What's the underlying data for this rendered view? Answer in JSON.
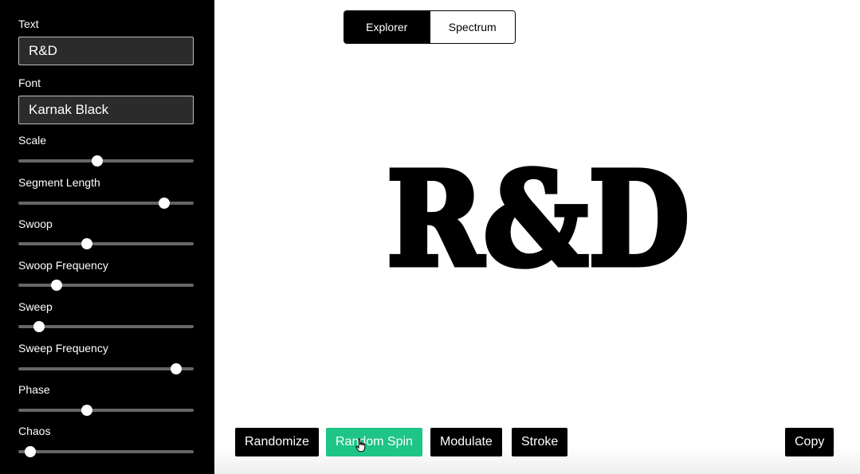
{
  "sidebar": {
    "text_label": "Text",
    "text_value": "R&D",
    "font_label": "Font",
    "font_value": "Karnak Black",
    "sliders": [
      {
        "label": "Scale",
        "value": 0.45
      },
      {
        "label": "Segment Length",
        "value": 0.83
      },
      {
        "label": "Swoop",
        "value": 0.39
      },
      {
        "label": "Swoop Frequency",
        "value": 0.22
      },
      {
        "label": "Sweep",
        "value": 0.12
      },
      {
        "label": "Sweep Frequency",
        "value": 0.9
      },
      {
        "label": "Phase",
        "value": 0.39
      },
      {
        "label": "Chaos",
        "value": 0.07
      }
    ]
  },
  "mode_tabs": [
    {
      "label": "Explorer",
      "active": true
    },
    {
      "label": "Spectrum",
      "active": false
    }
  ],
  "preview": {
    "text": "R&D"
  },
  "actions": {
    "randomize": "Randomize",
    "random_spin": "Random Spin",
    "modulate": "Modulate",
    "stroke": "Stroke",
    "copy": "Copy"
  },
  "colors": {
    "sidebar_bg": "#000000",
    "accent": "#1ec586",
    "slider_track": "#666666",
    "slider_thumb": "#ffffff"
  }
}
